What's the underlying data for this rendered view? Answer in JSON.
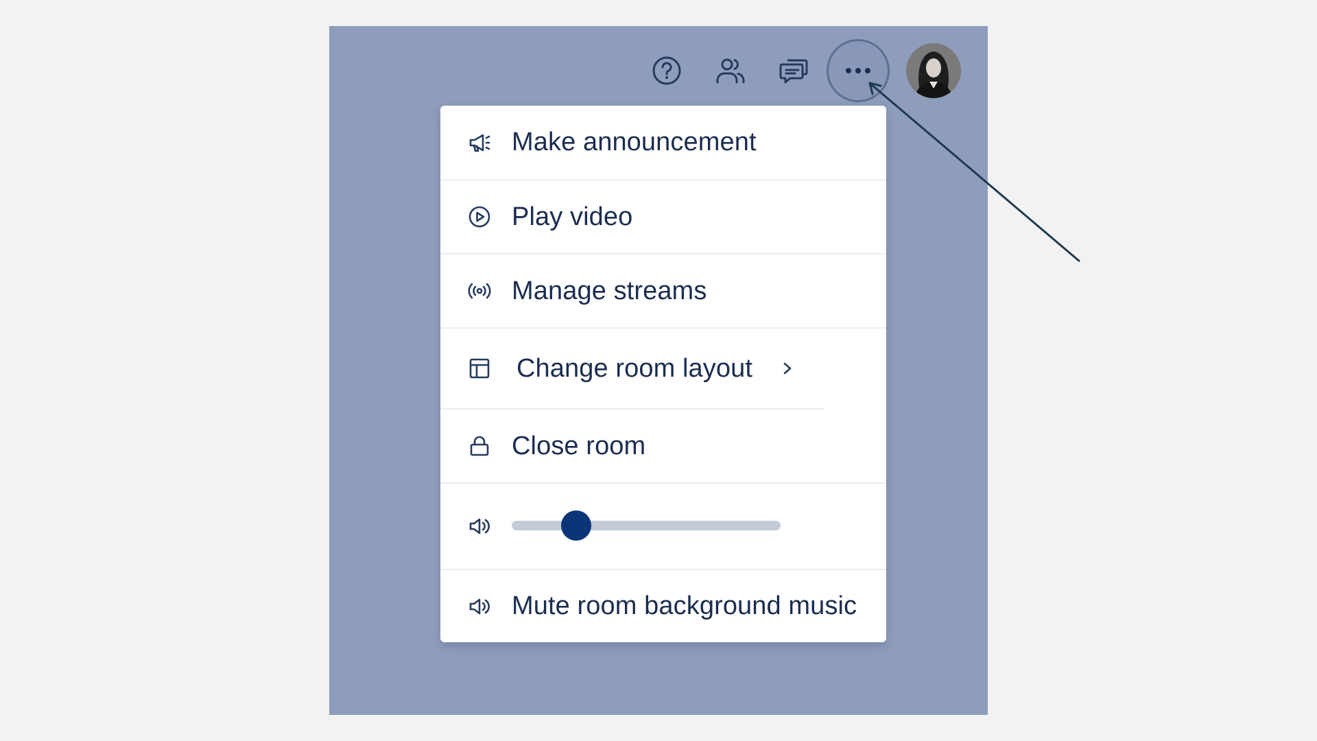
{
  "colors": {
    "page_background": "#f2f2f2",
    "room_background": "#8f9dbc",
    "menu_text": "#1b2d4f",
    "icon_color": "#243a5e",
    "slider_thumb": "#0b3576",
    "slider_track": "#c4cbd8",
    "annotation_arrow": "#1d3b4e"
  },
  "toolbar": {
    "icons": [
      "help-icon",
      "people-icon",
      "chat-icon",
      "more-icon",
      "avatar"
    ]
  },
  "menu": {
    "items": [
      {
        "label": "Make announcement",
        "icon": "megaphone-icon"
      },
      {
        "label": "Play video",
        "icon": "play-circle-icon"
      },
      {
        "label": "Manage streams",
        "icon": "broadcast-icon"
      },
      {
        "label": "Change room layout",
        "icon": "layout-icon",
        "has_submenu": true
      },
      {
        "label": "Close room",
        "icon": "lock-icon"
      },
      {
        "label": "Mute room background music",
        "icon": "speaker-icon"
      }
    ],
    "volume": {
      "icon": "speaker-icon",
      "level": 0.24
    }
  }
}
